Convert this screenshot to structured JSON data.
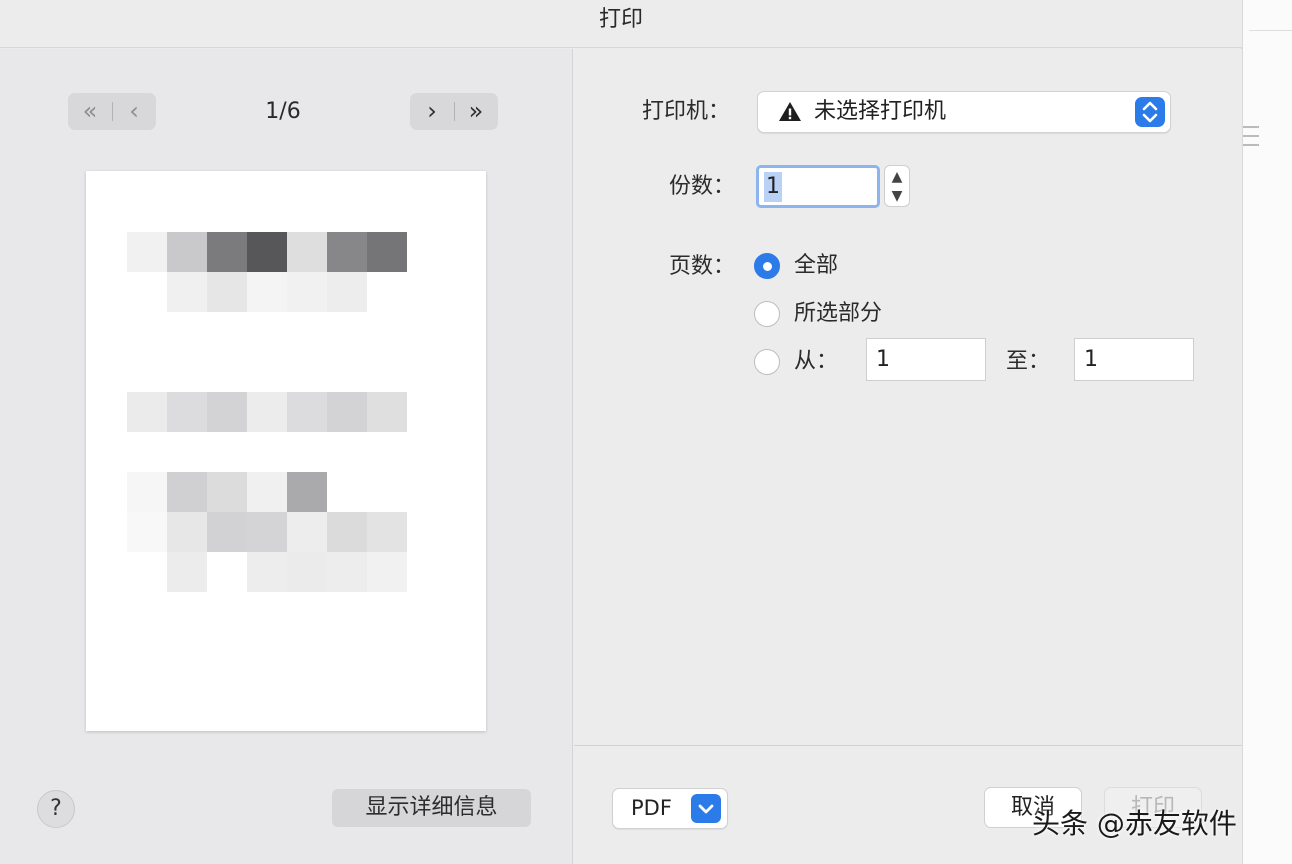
{
  "window": {
    "title": "打印"
  },
  "preview": {
    "page_indicator": "1/6",
    "prev": {
      "first_icon": "double-chevron-left",
      "prev_icon": "chevron-left",
      "first_glyph": "«",
      "prev_glyph": "‹"
    },
    "next": {
      "next_icon": "chevron-right",
      "last_icon": "double-chevron-right",
      "next_glyph": "›",
      "last_glyph": "»"
    },
    "help_label": "?",
    "details_label": "显示详细信息"
  },
  "settings": {
    "printer_label": "打印机：",
    "printer_value": "未选择打印机",
    "copies_label": "份数：",
    "copies_value": "1",
    "pages_label": "页数：",
    "pages_options": {
      "all": "全部",
      "selection": "所选部分",
      "from": "从："
    },
    "pages_selected": "all",
    "from_value": "1",
    "to_label": "至：",
    "to_value": "1"
  },
  "footer": {
    "pdf_label": "PDF",
    "cancel_label": "取消",
    "print_label": "打印"
  },
  "watermark": "头条 @赤友软件",
  "colors": {
    "accent": "#2b7be8",
    "focus_ring": "#8cb4ee"
  }
}
